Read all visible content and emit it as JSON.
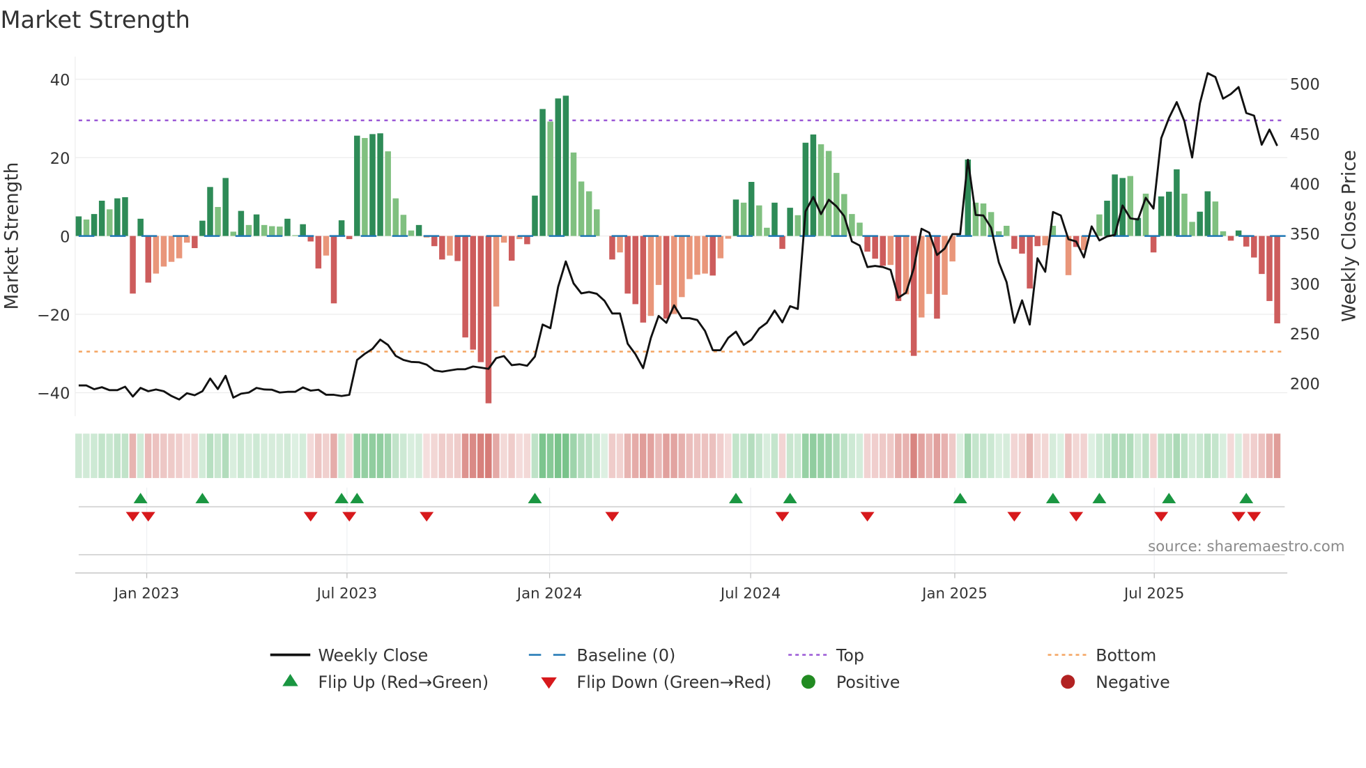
{
  "title": "Market Strength",
  "source": "source: sharemaestro.com",
  "chart_data": {
    "type": "bar",
    "title": "Market Strength",
    "ylabel": "Market Strength",
    "y2label": "Weekly Close Price",
    "ylim": [
      -46,
      46
    ],
    "y2lim": [
      176,
      518
    ],
    "yticks": [
      40,
      20,
      0,
      -20,
      -40
    ],
    "ytick_labels": [
      "40",
      "20",
      "0",
      "−20",
      "−40"
    ],
    "y2ticks": [
      500,
      450,
      400,
      350,
      300,
      250,
      200
    ],
    "y2tick_labels": [
      "500",
      "450",
      "400",
      "350",
      "300",
      "250",
      "200"
    ],
    "xticks": [
      {
        "week_index": 8.8,
        "label": "Jan 2023"
      },
      {
        "week_index": 34.7,
        "label": "Jul 2023"
      },
      {
        "week_index": 60.9,
        "label": "Jan 2024"
      },
      {
        "week_index": 86.9,
        "label": "Jul 2024"
      },
      {
        "week_index": 113.3,
        "label": "Jan 2025"
      },
      {
        "week_index": 139.1,
        "label": "Jul 2025"
      }
    ],
    "top_level": 29.5,
    "bottom_level": -29.5,
    "strength": [
      5.0,
      4.2,
      5.6,
      9.0,
      6.8,
      9.6,
      9.9,
      -14.7,
      4.4,
      -11.9,
      -9.6,
      -7.8,
      -6.6,
      -5.7,
      -1.7,
      -3.1,
      3.9,
      12.5,
      7.4,
      14.8,
      1.1,
      6.4,
      2.8,
      5.5,
      2.8,
      2.5,
      2.4,
      4.4,
      0.2,
      3.0,
      -1.4,
      -8.3,
      -5.0,
      -17.2,
      4.0,
      -0.8,
      25.6,
      25.0,
      26.0,
      26.2,
      21.6,
      9.6,
      5.4,
      1.4,
      2.8,
      -0.4,
      -2.6,
      -6.0,
      -5.0,
      -6.4,
      -25.9,
      -29.0,
      -32.2,
      -42.7,
      -18.0,
      -1.7,
      -6.3,
      -0.8,
      -2.1,
      10.3,
      32.4,
      29.2,
      35.1,
      35.8,
      21.3,
      13.9,
      11.4,
      6.8,
      0,
      -6.0,
      -4.2,
      -14.7,
      -17.4,
      -22.1,
      -20.4,
      -12.5,
      -21.1,
      -19.9,
      -15.6,
      -11.0,
      -9.9,
      -9.6,
      -10.1,
      -5.7,
      -0.7,
      9.3,
      8.5,
      13.8,
      7.8,
      2.1,
      8.5,
      -3.3,
      7.2,
      5.3,
      23.8,
      25.9,
      23.4,
      21.7,
      16.1,
      10.7,
      5.6,
      3.4,
      -4.0,
      -5.8,
      -7.6,
      -7.4,
      -16.6,
      -14.9,
      -30.6,
      -20.8,
      -14.8,
      -21.1,
      -15.0,
      -6.5,
      0,
      19.5,
      8.5,
      8.3,
      6.1,
      1.2,
      2.6,
      -3.3,
      -4.5,
      -13.4,
      -2.6,
      -2.4,
      2.6,
      0,
      -10.0,
      -2.8,
      -3.6,
      0,
      5.5,
      9.0,
      15.7,
      14.8,
      15.3,
      4.6,
      10.8,
      -4.2,
      10.1,
      11.3,
      17.0,
      10.8,
      3.6,
      6.2,
      11.4,
      8.8,
      1.2,
      -1.2,
      1.4,
      -2.7,
      -5.5,
      -9.7,
      -16.6,
      -22.3
    ],
    "strength_shade": [
      "dark",
      "light",
      "dark",
      "dark",
      "light",
      "dark",
      "dark",
      "dark",
      "dark",
      "dark",
      "light",
      "light",
      "light",
      "light",
      "light",
      "dark",
      "dark",
      "dark",
      "light",
      "dark",
      "light",
      "dark",
      "light",
      "dark",
      "light",
      "light",
      "light",
      "dark",
      "light",
      "dark",
      "dark",
      "dark",
      "light",
      "dark",
      "dark",
      "dark",
      "dark",
      "light",
      "dark",
      "dark",
      "light",
      "light",
      "light",
      "light",
      "dark",
      "light",
      "dark",
      "dark",
      "light",
      "dark",
      "dark",
      "dark",
      "dark",
      "dark",
      "light",
      "light",
      "dark",
      "light",
      "dark",
      "dark",
      "dark",
      "light",
      "dark",
      "dark",
      "light",
      "light",
      "light",
      "light",
      "light",
      "dark",
      "light",
      "dark",
      "dark",
      "dark",
      "light",
      "light",
      "dark",
      "light",
      "light",
      "light",
      "light",
      "light",
      "dark",
      "light",
      "light",
      "dark",
      "light",
      "dark",
      "light",
      "light",
      "dark",
      "dark",
      "dark",
      "light",
      "dark",
      "dark",
      "light",
      "light",
      "light",
      "light",
      "light",
      "light",
      "dark",
      "dark",
      "dark",
      "light",
      "dark",
      "light",
      "dark",
      "light",
      "light",
      "dark",
      "light",
      "light",
      "light",
      "dark",
      "light",
      "light",
      "light",
      "light",
      "light",
      "dark",
      "dark",
      "dark",
      "dark",
      "light",
      "light",
      "dark",
      "light",
      "dark",
      "light",
      "dark",
      "light",
      "dark",
      "dark",
      "dark",
      "light",
      "dark",
      "light",
      "dark",
      "dark",
      "dark",
      "dark",
      "light",
      "light",
      "dark",
      "dark",
      "light",
      "light",
      "dark",
      "dark",
      "dark",
      "dark",
      "dark",
      "dark",
      "dark"
    ],
    "weekly_close": [
      197.7,
      197.7,
      194,
      196,
      193,
      193,
      196.5,
      186.7,
      195.3,
      192,
      193.7,
      192,
      187.2,
      183.7,
      190,
      188,
      192,
      204.7,
      194.2,
      207.4,
      185.6,
      189.5,
      190.7,
      195.3,
      193.7,
      193.5,
      190.7,
      191.4,
      191.4,
      195.8,
      192.6,
      193.5,
      188.4,
      188.4,
      187.2,
      188.4,
      223.3,
      229.5,
      234.4,
      243.7,
      238.4,
      227.4,
      223.3,
      221.4,
      221,
      218.6,
      212.8,
      211.6,
      212.8,
      214,
      214,
      216.7,
      215.6,
      214.4,
      225.1,
      227.2,
      218.1,
      219,
      217.4,
      226.7,
      258.8,
      255.1,
      296.5,
      322,
      300,
      290,
      291.4,
      289.5,
      282.6,
      269.8,
      269.8,
      239.5,
      229,
      215.1,
      245.3,
      267.4,
      260.5,
      277.9,
      265.1,
      265.1,
      263.3,
      252.3,
      233,
      233,
      245.3,
      251.6,
      238.4,
      243.7,
      254.7,
      260.5,
      272.8,
      260.9,
      277.2,
      274.4,
      372.1,
      386.5,
      369.3,
      383.7,
      377.2,
      367.4,
      341.9,
      337.9,
      316.3,
      317.4,
      316.3,
      313.5,
      285.6,
      290.7,
      315.1,
      354.7,
      350.7,
      328.4,
      334.9,
      349.3,
      349.3,
      423.7,
      368.4,
      367.9,
      355.8,
      320.9,
      301.2,
      260.5,
      283,
      258.8,
      325.1,
      311.6,
      371.4,
      367.9,
      344.2,
      341.9,
      326,
      357,
      343,
      347,
      348.4,
      377.9,
      365.1,
      363.9,
      385.6,
      374.9,
      445.3,
      465.6,
      481.4,
      462.3,
      426,
      480.2,
      510.5,
      506.5,
      484.9,
      489.5,
      496.5,
      470.5,
      467.9,
      438.8,
      454,
      437.7
    ],
    "flip_up_weeks": [
      8,
      16,
      34,
      36,
      59,
      85,
      92,
      114,
      126,
      132,
      141,
      151
    ],
    "flip_down_weeks": [
      7,
      9,
      30,
      35,
      45,
      69,
      91,
      102,
      121,
      129,
      140,
      150,
      152
    ],
    "legend": [
      {
        "label": "Weekly Close",
        "symbol": "line",
        "color": "#111111"
      },
      {
        "label": "Baseline (0)",
        "symbol": "dash",
        "color": "#1f77b4"
      },
      {
        "label": "Top",
        "symbol": "dot",
        "color": "#9b59d6"
      },
      {
        "label": "Bottom",
        "symbol": "dot",
        "color": "#f4a460"
      },
      {
        "label": "Flip Up (Red→Green)",
        "symbol": "triangle-up",
        "color": "#1a9641"
      },
      {
        "label": "Flip Down (Green→Red)",
        "symbol": "triangle-down",
        "color": "#d7191c"
      },
      {
        "label": "Positive",
        "symbol": "circle",
        "color": "#228b22"
      },
      {
        "label": "Negative",
        "symbol": "circle",
        "color": "#b22222"
      }
    ],
    "legend_position": "bottom",
    "colors": {
      "pos_dark": "#2e8b57",
      "pos_light": "#80c080",
      "neg_dark": "#cd5c5c",
      "neg_light": "#e9967a",
      "baseline": "#1f77b4",
      "top": "#9b59d6",
      "bottom": "#f4a460",
      "price": "#111111",
      "flip_up": "#1a9641",
      "flip_down": "#d7191c"
    }
  }
}
